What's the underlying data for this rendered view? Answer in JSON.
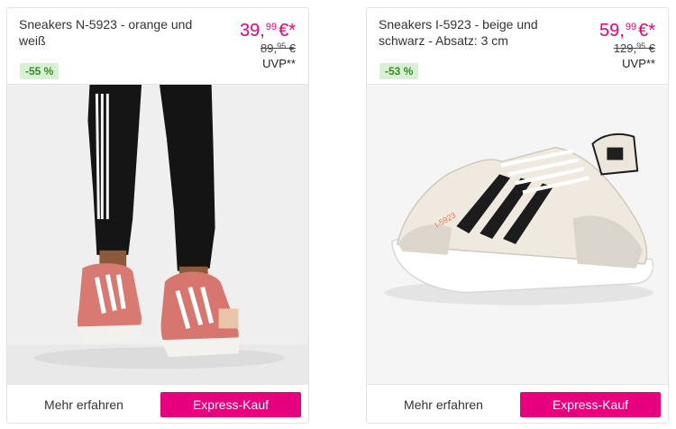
{
  "products": [
    {
      "title": "Sneakers N-5923 - orange und weiß",
      "price_main": "39,",
      "price_cents": "99",
      "price_currency": "€*",
      "old_price_main": "89,",
      "old_price_cents": "95",
      "old_price_currency": "€",
      "uvp_label": "UVP**",
      "discount": "-55 %",
      "more_label": "Mehr erfahren",
      "express_label": "Express-Kauf",
      "image_icon": "sneaker-on-feet-photo"
    },
    {
      "title": "Sneakers I-5923 - beige und schwarz - Absatz: 3 cm",
      "price_main": "59,",
      "price_cents": "99",
      "price_currency": "€*",
      "old_price_main": "129,",
      "old_price_cents": "95",
      "old_price_currency": "€",
      "uvp_label": "UVP**",
      "discount": "-53 %",
      "more_label": "Mehr erfahren",
      "express_label": "Express-Kauf",
      "image_icon": "sneaker-product-photo"
    }
  ],
  "colors": {
    "accent": "#e6007e",
    "badge_bg": "#d8f1d4",
    "badge_text": "#3a8a2c"
  }
}
